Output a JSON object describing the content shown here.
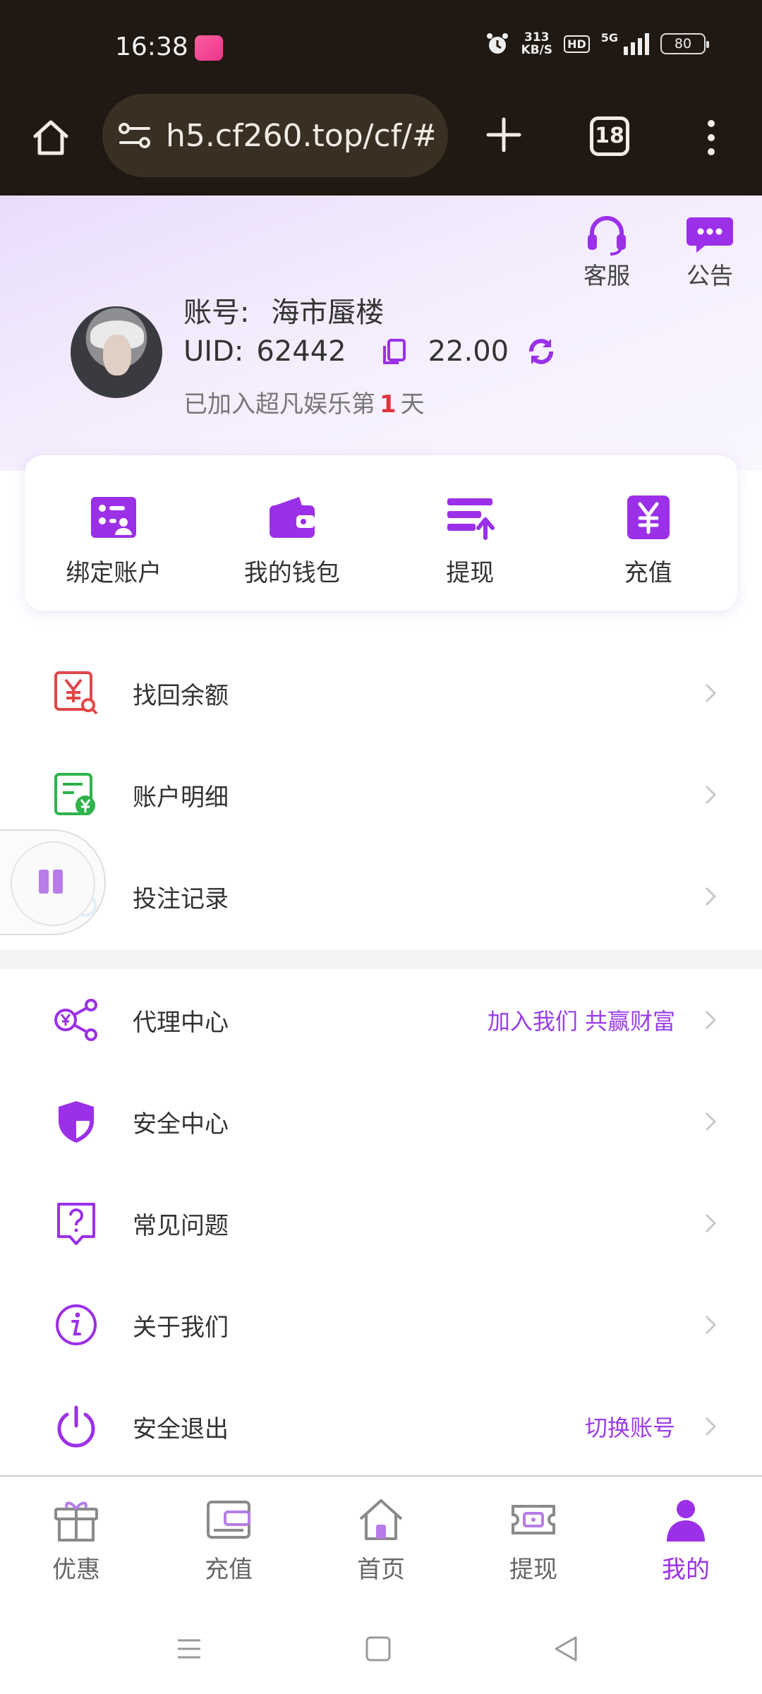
{
  "status_bar": {
    "time": "16:38",
    "net_speed_value": "313",
    "net_speed_unit": "KB/S",
    "hd_badge": "HD",
    "network_type": "5G",
    "battery": "80"
  },
  "browser": {
    "url": "h5.cf260.top/cf/#",
    "tab_count": "18"
  },
  "header": {
    "service_label": "客服",
    "notice_label": "公告",
    "account_label": "账号:",
    "account_name": "海市蜃楼",
    "uid_label": "UID:",
    "uid_value": "62442",
    "balance": "22.00",
    "joined_prefix": "已加入超凡娱乐第",
    "joined_days": "1",
    "joined_suffix": "天"
  },
  "quick_actions": [
    {
      "label": "绑定账户",
      "icon": "bind-account-icon"
    },
    {
      "label": "我的钱包",
      "icon": "wallet-icon"
    },
    {
      "label": "提现",
      "icon": "withdraw-icon"
    },
    {
      "label": "充值",
      "icon": "recharge-icon"
    }
  ],
  "menu_group_1": [
    {
      "label": "找回余额",
      "icon": "recover-balance-icon"
    },
    {
      "label": "账户明细",
      "icon": "account-detail-icon"
    },
    {
      "label": "投注记录",
      "icon": "bet-record-icon"
    }
  ],
  "menu_group_2": [
    {
      "label": "代理中心",
      "icon": "agent-share-icon",
      "extra": "加入我们 共赢财富"
    },
    {
      "label": "安全中心",
      "icon": "shield-icon",
      "extra": ""
    },
    {
      "label": "常见问题",
      "icon": "question-icon",
      "extra": ""
    },
    {
      "label": "关于我们",
      "icon": "info-icon",
      "extra": ""
    },
    {
      "label": "安全退出",
      "icon": "power-icon",
      "extra": "切换账号"
    }
  ],
  "bottom_nav": [
    {
      "label": "优惠",
      "icon": "gift-icon",
      "active": false
    },
    {
      "label": "充值",
      "icon": "card-icon",
      "active": false
    },
    {
      "label": "首页",
      "icon": "home-icon",
      "active": false
    },
    {
      "label": "提现",
      "icon": "ticket-icon",
      "active": false
    },
    {
      "label": "我的",
      "icon": "user-icon",
      "active": true
    }
  ],
  "colors": {
    "accent": "#9b30e8",
    "status_bar_bg": "#201812",
    "days_highlight": "#e0333f",
    "red_icon": "#e04848",
    "green_icon": "#2fb34a"
  }
}
